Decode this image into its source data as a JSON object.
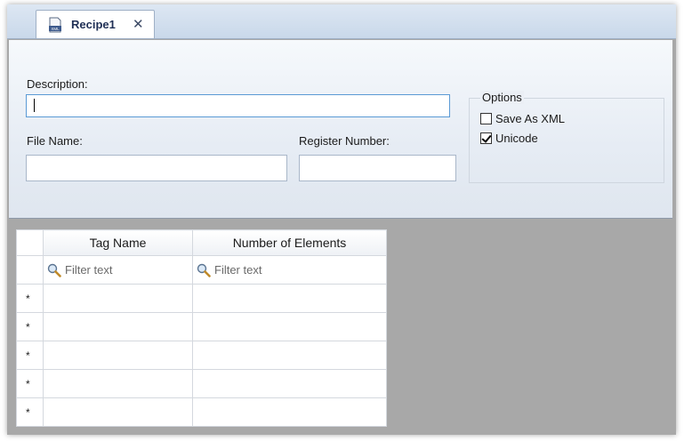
{
  "tab": {
    "title": "Recipe1",
    "icon": "xml-file-icon",
    "close_glyph": "✕"
  },
  "form": {
    "description": {
      "label": "Description:",
      "value": ""
    },
    "file_name": {
      "label": "File Name:",
      "value": ""
    },
    "register_number": {
      "label": "Register Number:",
      "value": ""
    },
    "options": {
      "title": "Options",
      "save_as_xml": {
        "label": "Save As XML",
        "checked": false
      },
      "unicode": {
        "label": "Unicode",
        "checked": true
      }
    }
  },
  "grid": {
    "columns": [
      "Tag Name",
      "Number of Elements"
    ],
    "filter_placeholder": "Filter text",
    "row_marker": "*",
    "rows": 5
  }
}
